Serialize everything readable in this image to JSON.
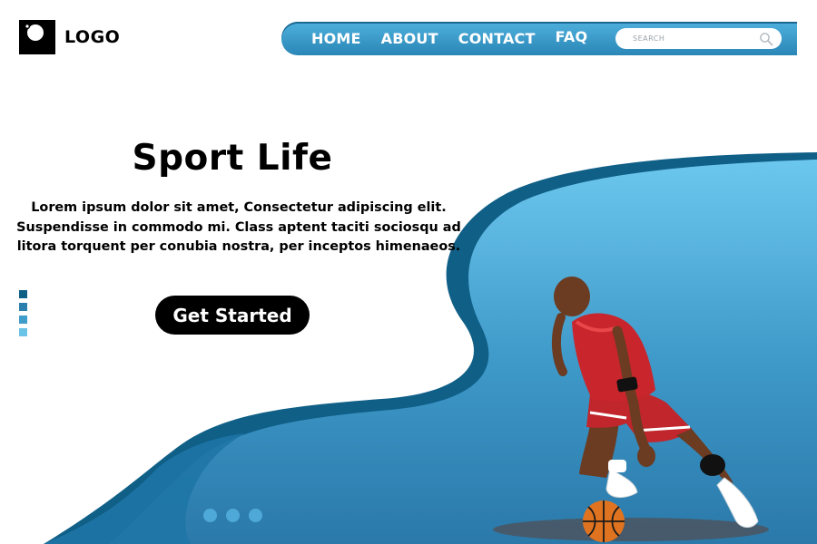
{
  "header": {
    "logo_text": "LOGO",
    "nav": [
      {
        "label": "HOME"
      },
      {
        "label": "ABOUT"
      },
      {
        "label": "CONTACT"
      },
      {
        "label": "FAQ"
      }
    ],
    "search": {
      "placeholder": "SEARCH",
      "icon": "search-icon"
    }
  },
  "hero": {
    "title": "Sport Life",
    "description": "Lorem ipsum dolor sit amet, Consectetur adipiscing elit. Suspendisse in commodo mi. Class aptent taciti sociosqu ad litora torquent per conubia nostra, per inceptos himenaeos.",
    "cta_label": "Get Started"
  },
  "colors": {
    "accent": "#2a86b6",
    "accent_light": "#4fb0dd",
    "dark_blue": "#0e5e86",
    "text": "#000000"
  },
  "carousel": {
    "dots": 3
  },
  "side_indicator": {
    "items": 4
  },
  "illustration": {
    "subject": "basketball-player-illustration"
  }
}
